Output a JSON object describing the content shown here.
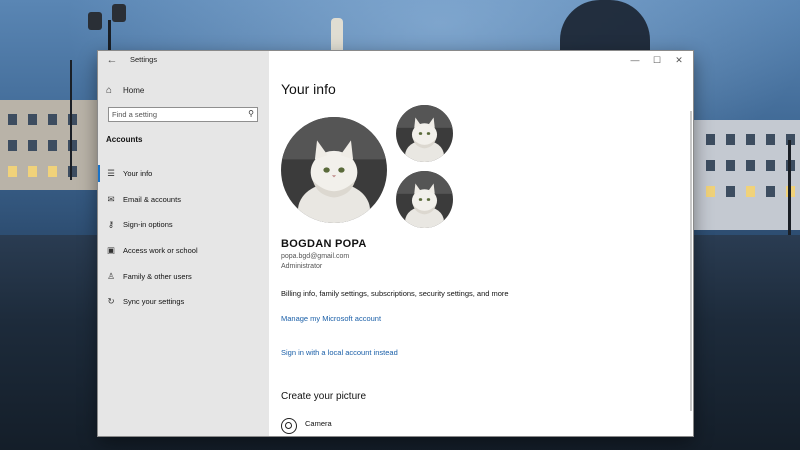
{
  "window": {
    "title": "Settings",
    "back_icon": "back-arrow-icon",
    "controls": {
      "minimize": "—",
      "maximize": "☐",
      "close": "✕"
    }
  },
  "sidebar": {
    "home_label": "Home",
    "search_placeholder": "Find a setting",
    "section_title": "Accounts",
    "items": [
      {
        "label": "Your info",
        "icon": "person-card-icon",
        "active": true
      },
      {
        "label": "Email & accounts",
        "icon": "mail-icon",
        "active": false
      },
      {
        "label": "Sign-in options",
        "icon": "key-icon",
        "active": false
      },
      {
        "label": "Access work or school",
        "icon": "briefcase-icon",
        "active": false
      },
      {
        "label": "Family & other users",
        "icon": "family-icon",
        "active": false
      },
      {
        "label": "Sync your settings",
        "icon": "sync-icon",
        "active": false
      }
    ]
  },
  "main": {
    "heading": "Your info",
    "user": {
      "name": "BOGDAN POPA",
      "email": "popa.bgd@gmail.com",
      "role": "Administrator"
    },
    "billing_text": "Billing info, family settings, subscriptions, security settings, and more",
    "manage_link": "Manage my Microsoft account",
    "local_link": "Sign in with a local account instead",
    "create_picture_heading": "Create your picture",
    "camera_label": "Camera"
  },
  "colors": {
    "accent": "#1a73c8",
    "link": "#1a5fa8",
    "sidebar_bg": "#e6e6e6"
  }
}
